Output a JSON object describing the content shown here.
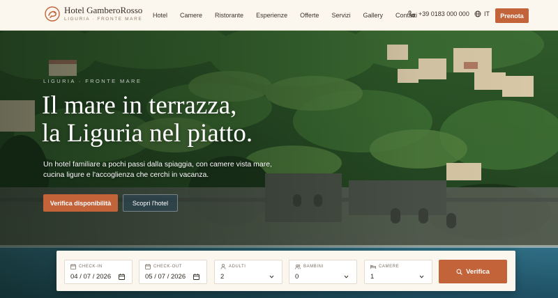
{
  "brand": {
    "name": "Hotel GamberoRosso",
    "tagline": "LIGURIA · FRONTE MARE"
  },
  "nav": {
    "items": [
      "Hotel",
      "Camere",
      "Ristorante",
      "Esperienze",
      "Offerte",
      "Servizi",
      "Gallery",
      "Contatti"
    ]
  },
  "header": {
    "phone": "+39 0183 000 000",
    "language": "IT",
    "book_label": "Prenota"
  },
  "hero": {
    "eyebrow": "LIGURIA · FRONTE MARE",
    "headline_line1": "Il mare in terrazza,",
    "headline_line2": "la Liguria nel piatto.",
    "subtitle": "Un hotel familiare a pochi passi dalla spiaggia, con camere vista mare, cucina ligure e l'accoglienza che cerchi in vacanza.",
    "cta_primary": "Verifica disponibilità",
    "cta_secondary": "Scopri l'hotel"
  },
  "booking": {
    "checkin": {
      "label": "CHECK-IN",
      "value": "04 / 07 / 2026"
    },
    "checkout": {
      "label": "CHECK-OUT",
      "value": "05 / 07 / 2026"
    },
    "adults": {
      "label": "ADULTI",
      "value": "2"
    },
    "children": {
      "label": "BAMBINI",
      "value": "0"
    },
    "rooms": {
      "label": "CAMERE",
      "value": "1"
    },
    "submit_label": "Verifica"
  },
  "colors": {
    "accent": "#c2633a",
    "header_bg": "#fbf6ee",
    "text_dark": "#3b3229"
  },
  "icons": [
    "logo-mark",
    "phone-icon",
    "globe-icon",
    "calendar-icon",
    "user-icon",
    "users-icon",
    "bed-icon",
    "chevron-down-icon",
    "search-icon"
  ]
}
